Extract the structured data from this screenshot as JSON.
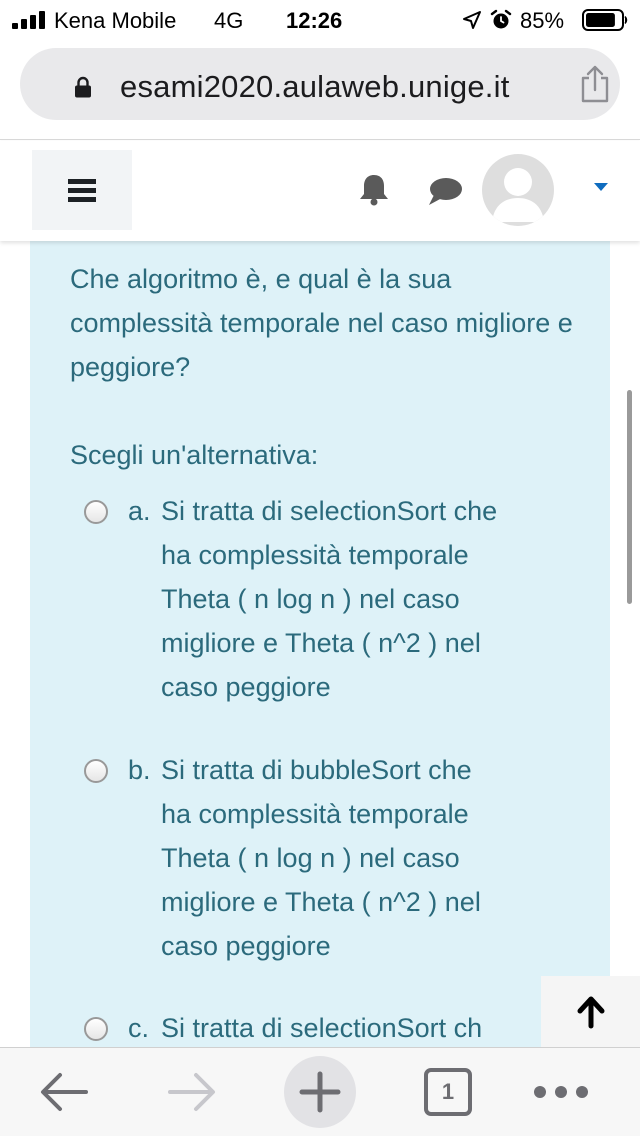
{
  "status_bar": {
    "carrier": "Kena Mobile",
    "network": "4G",
    "time": "12:26",
    "battery_percent": "85%",
    "battery_level": 0.85,
    "icons": [
      "signal-icon",
      "location-icon",
      "alarm-icon",
      "battery-icon"
    ]
  },
  "browser": {
    "url": "esami2020.aulaweb.unige.it",
    "lock_icon": "lock-icon",
    "share_icon": "share-icon"
  },
  "navbar": {
    "menu_icon": "hamburger-icon",
    "notifications_icon": "bell-icon",
    "messages_icon": "chat-icon",
    "avatar_icon": "user-avatar-icon",
    "caret_icon": "caret-down-icon"
  },
  "question": {
    "text": "Che algoritmo è, e qual è la sua complessità temporale nel caso migliore e peggiore?",
    "prompt": "Scegli un'alternativa:",
    "options": [
      {
        "letter": "a.",
        "text": "Si tratta di selectionSort che\nha complessità temporale\nTheta ( n log n ) nel caso\nmigliore e Theta ( n^2 ) nel\ncaso peggiore"
      },
      {
        "letter": "b.",
        "text": "Si tratta di bubbleSort che\nha complessità temporale\nTheta ( n log n ) nel caso\nmigliore e Theta ( n^2 ) nel\ncaso peggiore"
      },
      {
        "letter": "c.",
        "text": "Si tratta di selectionSort ch"
      }
    ]
  },
  "back_to_top": {
    "icon": "arrow-up-icon"
  },
  "toolbar": {
    "tabs_count": "1",
    "icons": [
      "back-arrow-icon",
      "forward-arrow-icon",
      "plus-icon",
      "tabs-icon",
      "more-icon"
    ]
  },
  "colors": {
    "content_bg": "#def2f8",
    "content_text": "#2b6a7c",
    "url_pill": "#e9e9eb",
    "caret_accent": "#0f6cbf"
  }
}
